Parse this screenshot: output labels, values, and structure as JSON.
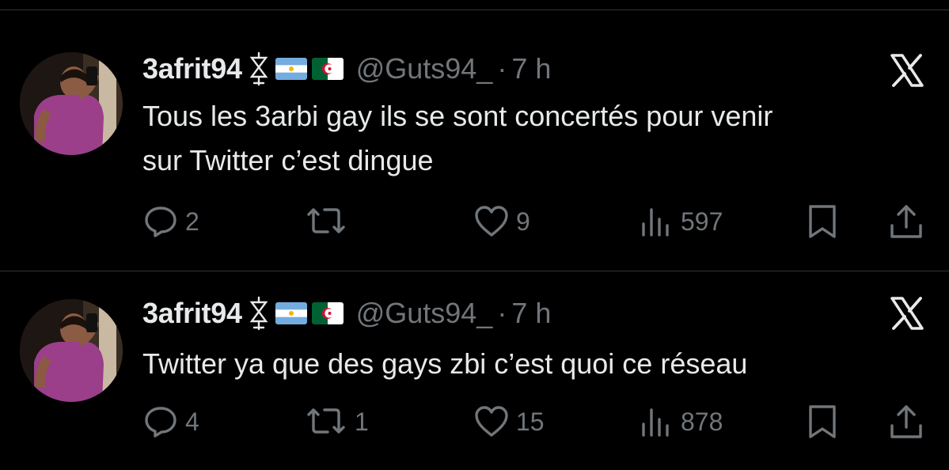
{
  "colors": {
    "background": "#000000",
    "primary_text": "#e7e9ea",
    "secondary_text": "#71767b",
    "divider": "#2f3336"
  },
  "tweets": [
    {
      "display_name": "3afrit94",
      "handle": "@Guts94_",
      "separator": "·",
      "time": "7 h",
      "text_lines": [
        "Tous les 3arbi gay ils se sont concertés pour venir",
        "sur Twitter c’est dingue"
      ],
      "actions": {
        "replies": "2",
        "retweets": "",
        "likes": "9",
        "views": "597"
      },
      "icons": [
        "reply-icon",
        "retweet-icon",
        "like-icon",
        "views-icon",
        "bookmark-icon",
        "share-icon"
      ]
    },
    {
      "display_name": "3afrit94",
      "handle": "@Guts94_",
      "separator": "·",
      "time": "7 h",
      "text_lines": [
        "Twitter ya que des gays zbi c’est quoi ce réseau"
      ],
      "actions": {
        "replies": "4",
        "retweets": "1",
        "likes": "15",
        "views": "878"
      },
      "icons": [
        "reply-icon",
        "retweet-icon",
        "like-icon",
        "views-icon",
        "bookmark-icon",
        "share-icon"
      ]
    }
  ]
}
